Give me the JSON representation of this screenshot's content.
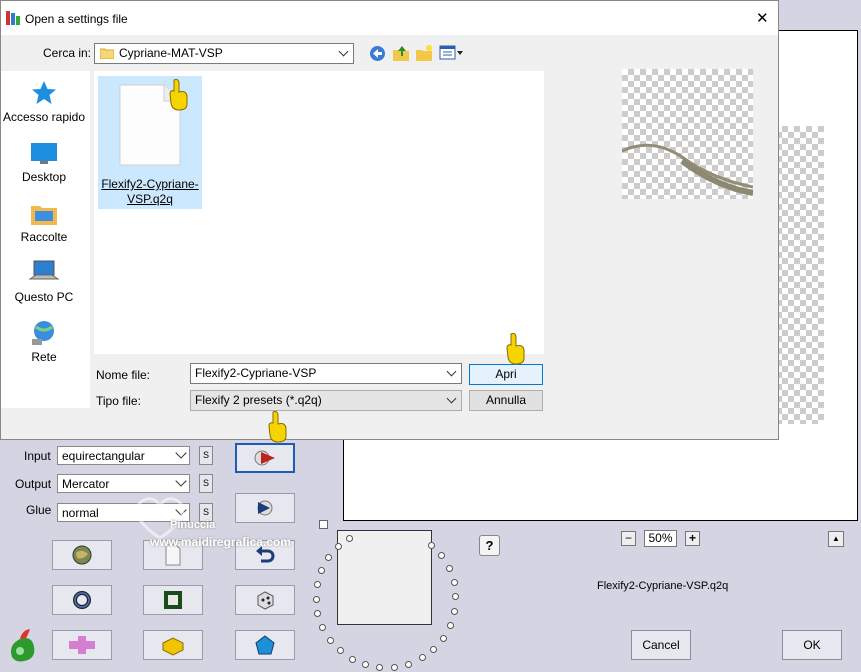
{
  "dialog": {
    "title": "Open a settings file",
    "look_in_label": "Cerca in:",
    "look_in_value": "Cypriane-MAT-VSP",
    "places": [
      {
        "label": "Accesso rapido",
        "icon": "star-icon"
      },
      {
        "label": "Desktop",
        "icon": "desktop-icon"
      },
      {
        "label": "Raccolte",
        "icon": "folder-library-icon"
      },
      {
        "label": "Questo PC",
        "icon": "computer-icon"
      },
      {
        "label": "Rete",
        "icon": "network-icon"
      }
    ],
    "file_item": {
      "name_line1": "Flexify2-Cypriane-",
      "name_line2": "VSP.q2q"
    },
    "file_name_label": "Nome file:",
    "file_name_value": "Flexify2-Cypriane-VSP",
    "file_type_label": "Tipo file:",
    "file_type_value": "Flexify 2 presets (*.q2q)",
    "open_label": "Apri",
    "cancel_label": "Annulla",
    "close_glyph": "✕"
  },
  "app": {
    "input_label": "Input",
    "input_value": "equirectangular",
    "output_label": "Output",
    "output_value": "Mercator",
    "glue_label": "Glue",
    "glue_value": "normal",
    "s_label": "S",
    "zoom_minus": "−",
    "zoom_value": "50%",
    "zoom_plus": "+",
    "help_label": "?",
    "expand_label": "▲",
    "preset_filename": "Flexify2-Cypriane-VSP.q2q",
    "cancel_label": "Cancel",
    "ok_label": "OK"
  },
  "watermark": {
    "line1": "Pinuccia",
    "line2": "www.maidiregrafica.com"
  }
}
